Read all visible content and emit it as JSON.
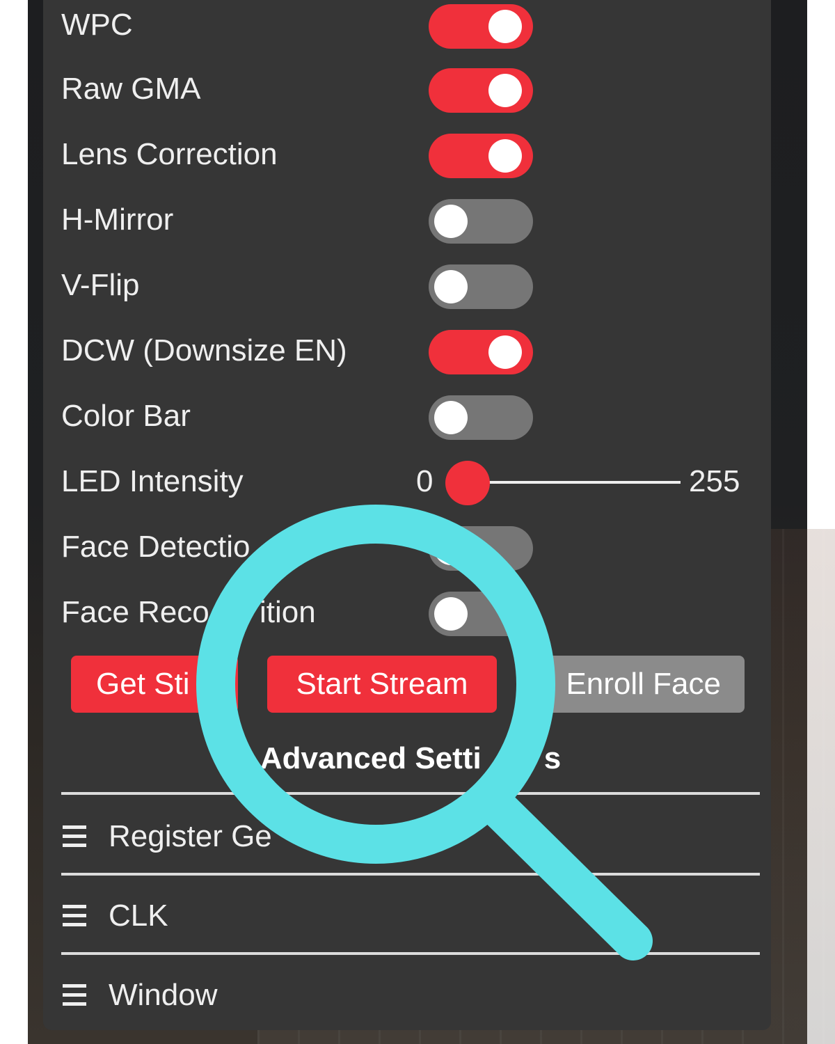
{
  "toggles": [
    {
      "label": "WPC",
      "on": true
    },
    {
      "label": "Raw GMA",
      "on": true
    },
    {
      "label": "Lens Correction",
      "on": true
    },
    {
      "label": "H-Mirror",
      "on": false
    },
    {
      "label": "V-Flip",
      "on": false
    },
    {
      "label": "DCW (Downsize EN)",
      "on": true
    },
    {
      "label": "Color Bar",
      "on": false
    }
  ],
  "led": {
    "label": "LED Intensity",
    "min": "0",
    "max": "255",
    "value": 0
  },
  "face_detection": {
    "label": "Face Detectio",
    "on": false
  },
  "face_recognition": {
    "label": "Face Reco",
    "label_tail": "ition",
    "on": false
  },
  "buttons": {
    "get_still": "Get Sti",
    "start_stream": "Start Stream",
    "enroll_face": "Enroll Face"
  },
  "advanced": {
    "title": "Advanced Setti",
    "title_tail": "s"
  },
  "sections": [
    {
      "label": "Register Ge"
    },
    {
      "label": "CLK"
    },
    {
      "label": "Window"
    }
  ],
  "colors": {
    "accent": "#f0303b",
    "toggle_off": "#767676",
    "panel": "#363636",
    "magnifier": "#5ce1e6",
    "button_disabled": "#8b8b8b"
  },
  "icons": {
    "menu": "hamburger-icon",
    "overlay": "magnifier-icon"
  }
}
